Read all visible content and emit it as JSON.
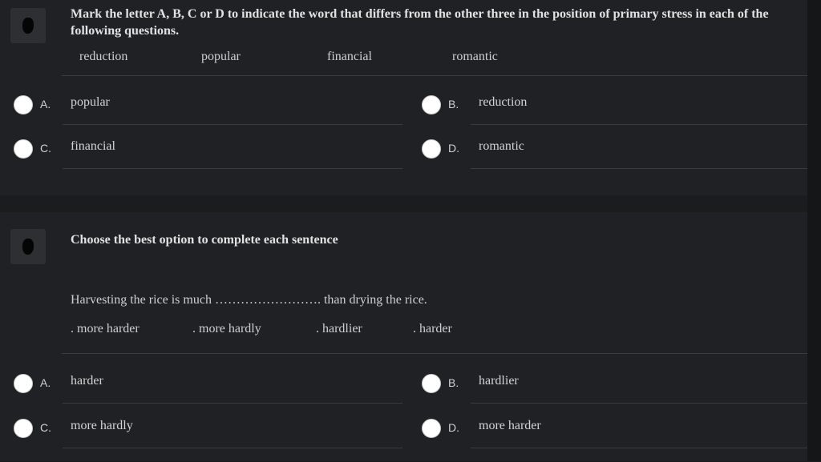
{
  "q1": {
    "instruction": "Mark the letter A, B, C or D to indicate the word that differs from the other three in the position of primary stress in each of the following questions.",
    "words": [
      "reduction",
      "popular",
      "financial",
      "romantic"
    ],
    "choices": [
      {
        "letter": "A.",
        "text": "popular"
      },
      {
        "letter": "B.",
        "text": "reduction"
      },
      {
        "letter": "C.",
        "text": "financial"
      },
      {
        "letter": "D.",
        "text": "romantic"
      }
    ]
  },
  "q2": {
    "instruction": "Choose the best option to complete each sentence",
    "sentence": "Harvesting the rice is much ……………………. than drying the rice.",
    "options": [
      ". more harder",
      ". more hardly",
      ". hardlier",
      ". harder"
    ],
    "choices": [
      {
        "letter": "A.",
        "text": "harder"
      },
      {
        "letter": "B.",
        "text": "hardlier"
      },
      {
        "letter": "C.",
        "text": "more hardly"
      },
      {
        "letter": "D.",
        "text": "more harder"
      }
    ]
  }
}
